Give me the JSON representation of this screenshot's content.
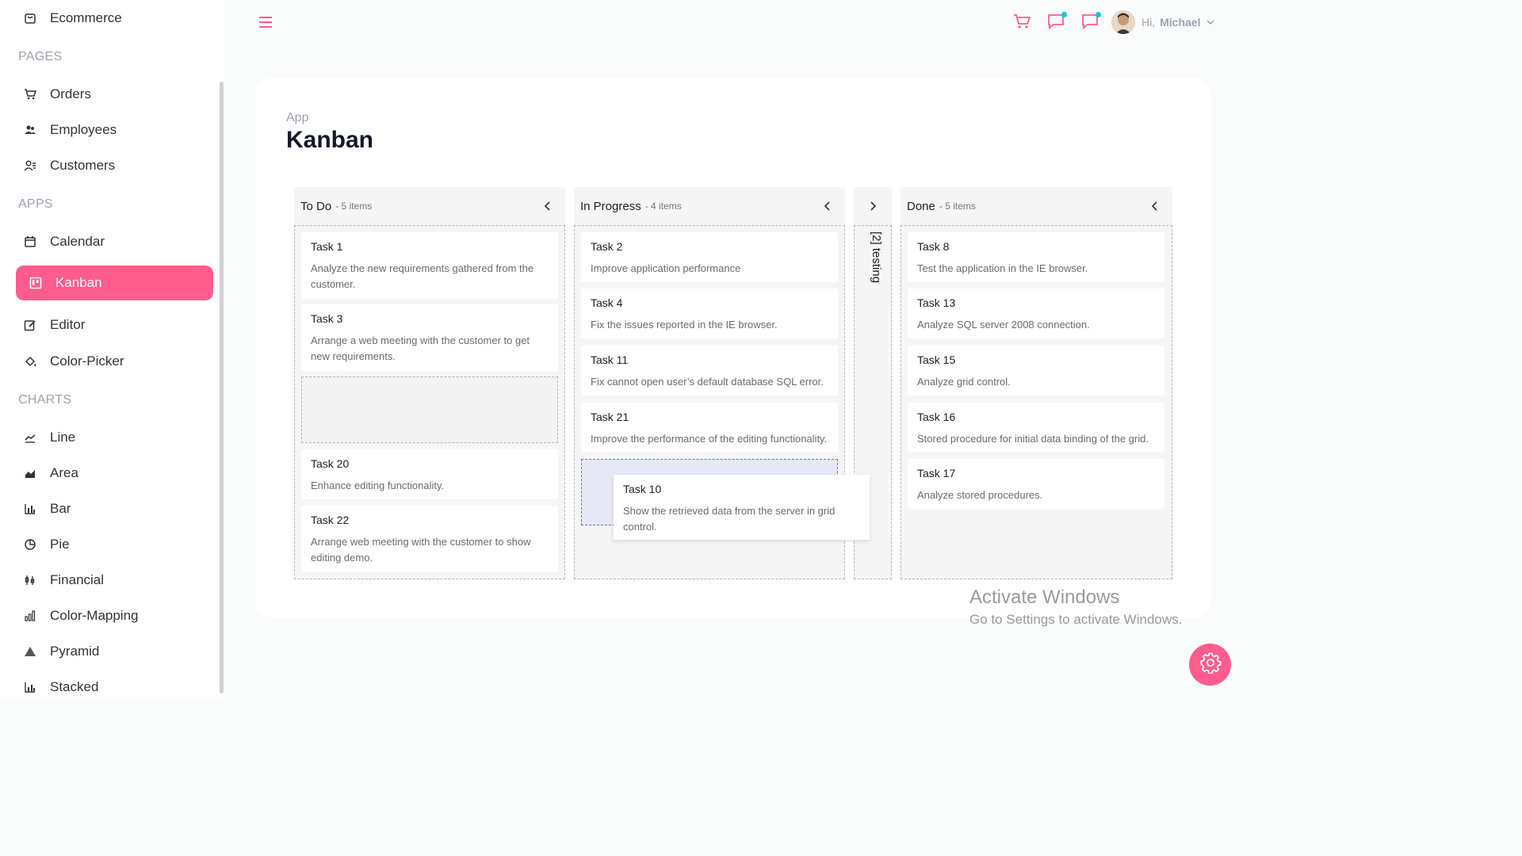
{
  "sidebar": {
    "top_item": {
      "label": "Ecommerce",
      "icon": "shopping-bag-icon"
    },
    "sections": {
      "pages": "PAGES",
      "apps": "APPS",
      "charts": "CHARTS"
    },
    "pages": [
      {
        "label": "Orders",
        "icon": "cart-icon"
      },
      {
        "label": "Employees",
        "icon": "people-icon"
      },
      {
        "label": "Customers",
        "icon": "contacts-icon"
      }
    ],
    "apps": [
      {
        "label": "Calendar",
        "icon": "calendar-icon"
      },
      {
        "label": "Kanban",
        "icon": "kanban-icon",
        "active": true
      },
      {
        "label": "Editor",
        "icon": "edit-icon"
      },
      {
        "label": "Color-Picker",
        "icon": "paint-bucket-icon"
      }
    ],
    "charts": [
      {
        "label": "Line",
        "icon": "line-chart-icon"
      },
      {
        "label": "Area",
        "icon": "area-chart-icon"
      },
      {
        "label": "Bar",
        "icon": "bar-chart-icon"
      },
      {
        "label": "Pie",
        "icon": "pie-chart-icon"
      },
      {
        "label": "Financial",
        "icon": "financial-chart-icon"
      },
      {
        "label": "Color-Mapping",
        "icon": "color-mapping-icon"
      },
      {
        "label": "Pyramid",
        "icon": "pyramid-icon"
      },
      {
        "label": "Stacked",
        "icon": "stacked-chart-icon"
      }
    ]
  },
  "topbar": {
    "greeting": "Hi,",
    "username": "Michael"
  },
  "page": {
    "breadcrumb": "App",
    "title": "Kanban"
  },
  "kanban": {
    "todo": {
      "name": "To Do",
      "count": "- 5 items",
      "tasks": [
        {
          "title": "Task 1",
          "desc": "Analyze the new requirements gathered from the customer."
        },
        {
          "title": "Task 3",
          "desc": "Arrange a web meeting with the customer to get new requirements."
        },
        {
          "title": "Task 20",
          "desc": "Enhance editing functionality."
        },
        {
          "title": "Task 22",
          "desc": "Arrange web meeting with the customer to show editing demo."
        }
      ]
    },
    "inprogress": {
      "name": "In Progress",
      "count": "- 4 items",
      "tasks": [
        {
          "title": "Task 2",
          "desc": "Improve application performance"
        },
        {
          "title": "Task 4",
          "desc": "Fix the issues reported in the IE browser."
        },
        {
          "title": "Task 11",
          "desc": "Fix cannot open user’s default database SQL error."
        },
        {
          "title": "Task 21",
          "desc": "Improve the performance of the editing functionality."
        }
      ]
    },
    "testing": {
      "label": "[2] testing"
    },
    "done": {
      "name": "Done",
      "count": "- 5 items",
      "tasks": [
        {
          "title": "Task 8",
          "desc": "Test the application in the IE browser."
        },
        {
          "title": "Task 13",
          "desc": "Analyze SQL server 2008 connection."
        },
        {
          "title": "Task 15",
          "desc": "Analyze grid control."
        },
        {
          "title": "Task 16",
          "desc": "Stored procedure for initial data binding of the grid."
        },
        {
          "title": "Task 17",
          "desc": "Analyze stored procedures."
        }
      ]
    },
    "dragging": {
      "title": "Task 10",
      "desc": "Show the retrieved data from the server in grid control."
    }
  },
  "watermark": {
    "line1": "Activate Windows",
    "line2": "Go to Settings to activate Windows."
  },
  "colors": {
    "accent": "#ff5c8e",
    "notification_dot": "#03c9d7"
  }
}
